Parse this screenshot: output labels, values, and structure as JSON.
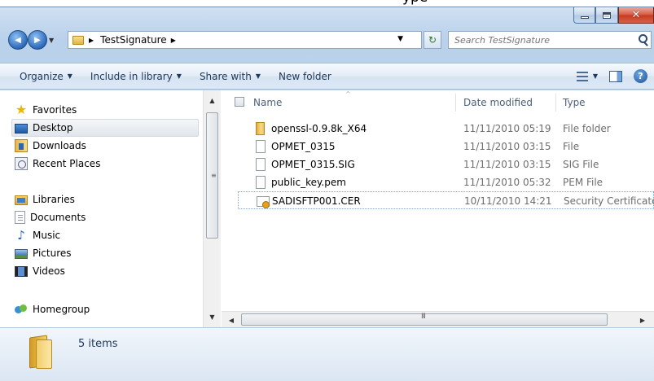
{
  "top_clip_text": "ype",
  "window": {
    "close_glyph": "✕"
  },
  "nav": {
    "back_arrow": "◀",
    "forward_arrow": "▶",
    "history_arrow": "▼",
    "breadcrumb": [
      "TestSignature"
    ],
    "crumb_separator": "▶",
    "address_dropdown": "▼",
    "refresh_glyph": "↻",
    "search_placeholder": "Search TestSignature"
  },
  "commandbar": {
    "items": [
      {
        "label": "Organize",
        "has_dropdown": true
      },
      {
        "label": "Include in library",
        "has_dropdown": true
      },
      {
        "label": "Share with",
        "has_dropdown": true
      },
      {
        "label": "New folder",
        "has_dropdown": false
      }
    ],
    "dropdown_arrow": "▼",
    "views_dropdown": "▼",
    "help_label": "?"
  },
  "sidebar": {
    "favorites": {
      "label": "Favorites",
      "items": [
        {
          "label": "Desktop",
          "icon": "desktop-icon",
          "selected": true
        },
        {
          "label": "Downloads",
          "icon": "downloads-icon"
        },
        {
          "label": "Recent Places",
          "icon": "recent-places-icon"
        }
      ]
    },
    "libraries": {
      "label": "Libraries",
      "items": [
        {
          "label": "Documents",
          "icon": "documents-icon"
        },
        {
          "label": "Music",
          "icon": "music-icon"
        },
        {
          "label": "Pictures",
          "icon": "pictures-icon"
        },
        {
          "label": "Videos",
          "icon": "videos-icon"
        }
      ]
    },
    "homegroup": {
      "label": "Homegroup"
    },
    "scroll_up": "▲",
    "scroll_down": "▼",
    "scroll_grip": "≡"
  },
  "filelist": {
    "columns": [
      "Name",
      "Date modified",
      "Type"
    ],
    "sort_caret": "^",
    "rows": [
      {
        "name": "openssl-0.9.8k_X64",
        "date": "11/11/2010 05:19",
        "type": "File folder",
        "icon": "folder-icon"
      },
      {
        "name": "OPMET_0315",
        "date": "11/11/2010 03:15",
        "type": "File",
        "icon": "file-icon"
      },
      {
        "name": "OPMET_0315.SIG",
        "date": "11/11/2010 03:15",
        "type": "SIG File",
        "icon": "file-icon"
      },
      {
        "name": "public_key.pem",
        "date": "11/11/2010 05:32",
        "type": "PEM File",
        "icon": "file-icon"
      },
      {
        "name": "SADISFTP001.CER",
        "date": "10/11/2010 14:21",
        "type": "Security Certificate",
        "icon": "certificate-icon"
      }
    ],
    "hscroll_left": "◀",
    "hscroll_right": "▶",
    "hscroll_grip": "III"
  },
  "details": {
    "items_count": "5 items"
  }
}
